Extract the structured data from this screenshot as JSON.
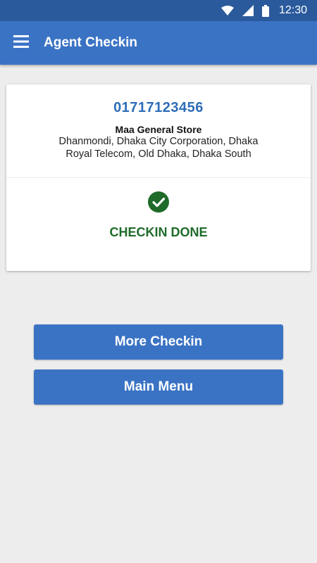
{
  "status_bar": {
    "time": "12:30",
    "icons": [
      "wifi-icon",
      "signal-icon",
      "battery-icon"
    ]
  },
  "app_bar": {
    "title": "Agent Checkin",
    "menu_icon": "hamburger-menu-icon",
    "color": "#3a73c4"
  },
  "agent": {
    "phone": "01717123456",
    "store_name": "Maa General Store",
    "address_line1": "Dhanmondi, Dhaka City Corporation, Dhaka",
    "address_line2": "Royal Telecom, Old Dhaka, Dhaka South"
  },
  "checkin": {
    "status_icon": "check-circle-icon",
    "status_text": "CHECKIN DONE",
    "status_color": "#1f6b2a"
  },
  "buttons": {
    "more_checkin": "More Checkin",
    "main_menu": "Main Menu"
  }
}
